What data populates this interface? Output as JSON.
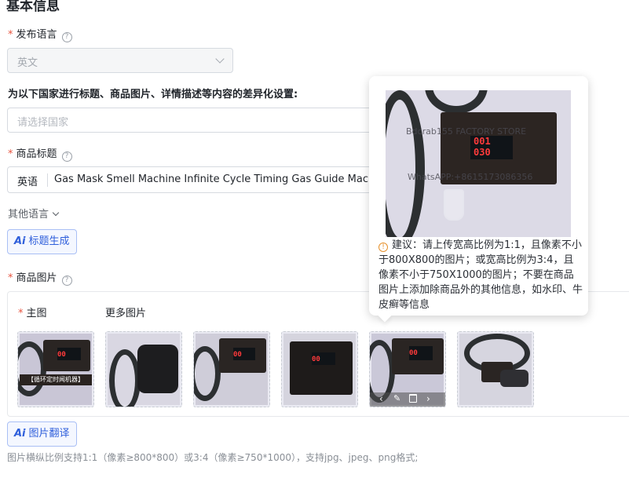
{
  "section": {
    "title": "基本信息"
  },
  "publish_language": {
    "label": "发布语言",
    "value": "英文"
  },
  "diff_settings": {
    "label": "为以下国家进行标题、商品图片、详情描述等内容的差异化设置:",
    "placeholder": "请选择国家"
  },
  "product_title": {
    "label": "商品标题",
    "lang": "英语",
    "value": "Gas Mask Smell Machine Infinite Cycle Timing Gas Guide Machine"
  },
  "other_languages": {
    "label": "其他语言"
  },
  "title_generate_button": {
    "ai": "Ai",
    "label": "标题生成"
  },
  "product_images": {
    "label": "商品图片",
    "main_label": "主图",
    "more_label": "更多图片"
  },
  "thumb_texts": {
    "t1_caption": "【循环定时闻机器】"
  },
  "image_translate_button": {
    "ai": "Ai",
    "label": "图片翻译"
  },
  "footnote": "图片横纵比例支持1:1（像素≥800*800）或3:4（像素≥750*1000），支持jpg、jpeg、png格式;",
  "tooltip": {
    "lcd_top": "001",
    "lcd_bottom": "030",
    "watermark1": "Bdcrab155 FACTORY STORE",
    "watermark2": "WhatsAPP:+8615173086356",
    "text": "建议：请上传宽高比例为1:1，且像素不小于800X800的图片；或宽高比例为3:4，且像素不小于750X1000的图片；不要在商品图片上添加除商品外的其他信息，如水印、牛皮癣等信息"
  },
  "colors": {
    "required": "#e8543f",
    "accent": "#2f5fdb",
    "lcd": "#ff3b3b"
  }
}
